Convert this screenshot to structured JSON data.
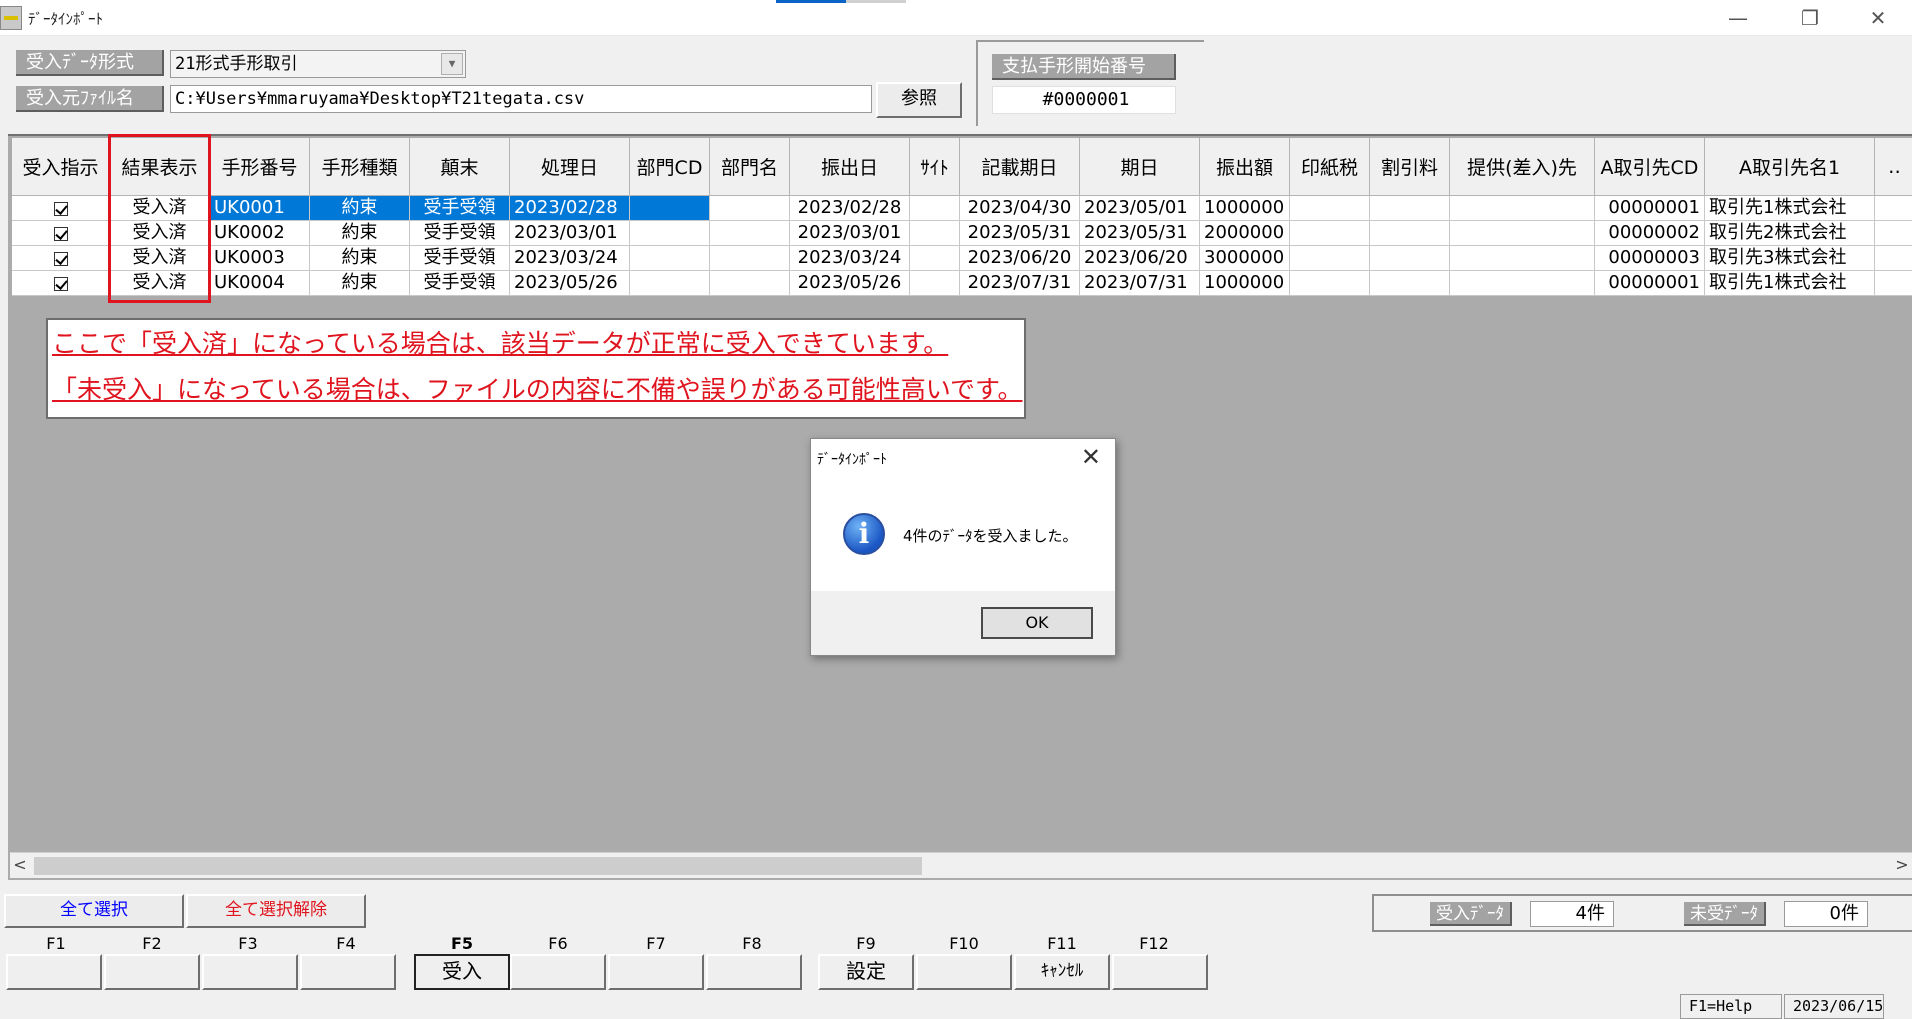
{
  "window": {
    "title": "ﾃﾞｰﾀｲﾝﾎﾟｰﾄ",
    "minimize_glyph": "—",
    "restore_glyph": "❐",
    "close_glyph": "✕"
  },
  "header": {
    "format_label": "受入ﾃﾞｰﾀ形式",
    "format_value": "21形式手形取引",
    "file_label": "受入元ﾌｧｲﾙ名",
    "file_value": "C:¥Users¥mmaruyama¥Desktop¥T21tegata.csv",
    "browse_button": "参照",
    "payment_start_label": "支払手形開始番号",
    "payment_start_value": "#0000001"
  },
  "grid": {
    "columns": [
      "受入指示",
      "結果表示",
      "手形番号",
      "手形種類",
      "顛末",
      "処理日",
      "部門CD",
      "部門名",
      "振出日",
      "ｻｲﾄ",
      "記載期日",
      "期日",
      "振出額",
      "印紙税",
      "割引料",
      "提供(差入)先",
      "A取引先CD",
      "A取引先名1",
      "‥"
    ],
    "rows": [
      {
        "result": "受入済",
        "note_no": "UK0001",
        "type": "約束",
        "status": "受手受領",
        "proc_date": "2023/02/28",
        "dept_cd": "",
        "dept_name": "",
        "issue_date": "2023/02/28",
        "site": "",
        "stated_due": "2023/04/30",
        "due": "2023/05/01",
        "amount": "1000000",
        "stamp": "",
        "discount": "",
        "provided_to": "",
        "partner_cd": "00000001",
        "partner_name": "取引先1株式会社"
      },
      {
        "result": "受入済",
        "note_no": "UK0002",
        "type": "約束",
        "status": "受手受領",
        "proc_date": "2023/03/01",
        "dept_cd": "",
        "dept_name": "",
        "issue_date": "2023/03/01",
        "site": "",
        "stated_due": "2023/05/31",
        "due": "2023/05/31",
        "amount": "2000000",
        "stamp": "",
        "discount": "",
        "provided_to": "",
        "partner_cd": "00000002",
        "partner_name": "取引先2株式会社"
      },
      {
        "result": "受入済",
        "note_no": "UK0003",
        "type": "約束",
        "status": "受手受領",
        "proc_date": "2023/03/24",
        "dept_cd": "",
        "dept_name": "",
        "issue_date": "2023/03/24",
        "site": "",
        "stated_due": "2023/06/20",
        "due": "2023/06/20",
        "amount": "3000000",
        "stamp": "",
        "discount": "",
        "provided_to": "",
        "partner_cd": "00000003",
        "partner_name": "取引先3株式会社"
      },
      {
        "result": "受入済",
        "note_no": "UK0004",
        "type": "約束",
        "status": "受手受領",
        "proc_date": "2023/05/26",
        "dept_cd": "",
        "dept_name": "",
        "issue_date": "2023/05/26",
        "site": "",
        "stated_due": "2023/07/31",
        "due": "2023/07/31",
        "amount": "1000000",
        "stamp": "",
        "discount": "",
        "provided_to": "",
        "partner_cd": "00000001",
        "partner_name": "取引先1株式会社"
      }
    ]
  },
  "annotation": {
    "line1": "ここで「受入済」になっている場合は、該当データが正常に受入できています。",
    "line2": "「未受入」になっている場合は、ファイルの内容に不備や誤りがある可能性高いです。",
    "color": "#e0141e"
  },
  "dialog": {
    "title": "ﾃﾞｰﾀｲﾝﾎﾟｰﾄ",
    "message": "4件のﾃﾞｰﾀを受入ました。",
    "ok": "OK",
    "icon": "info-icon",
    "close_glyph": "✕"
  },
  "bottom": {
    "select_all": "全て選択",
    "deselect_all": "全て選択解除",
    "imported_label": "受入ﾃﾞｰﾀ",
    "imported_count": "4件",
    "not_imported_label": "未受ﾃﾞｰﾀ",
    "not_imported_count": "0件"
  },
  "fkeys": {
    "labels": [
      "F1",
      "F2",
      "F3",
      "F4",
      "F5",
      "F6",
      "F7",
      "F8",
      "F9",
      "F10",
      "F11",
      "F12"
    ],
    "buttons": [
      "",
      "",
      "",
      "",
      "受入",
      "",
      "",
      "",
      "設定",
      "",
      "ｷｬﾝｾﾙ",
      ""
    ]
  },
  "status": {
    "help": "F1=Help",
    "date": "2023/06/15"
  },
  "scroll": {
    "left": "<",
    "right": ">"
  },
  "colors": {
    "selection": "#0078d7",
    "highlight_border": "#e0141e",
    "select_all_text": "#0000ff",
    "deselect_all_text": "#e0141e"
  }
}
